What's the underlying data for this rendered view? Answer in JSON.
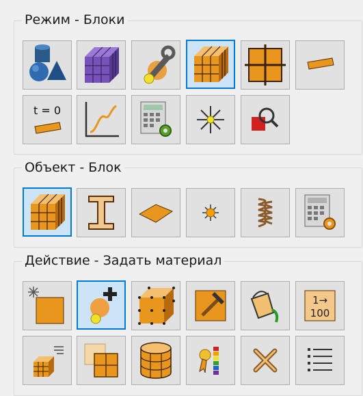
{
  "colors": {
    "selected_border": "#0078d7",
    "selected_bg": "#cce4f7",
    "button_bg": "#e1e1e1"
  },
  "sections": [
    {
      "title": "Режим - Блоки",
      "buttons": [
        {
          "icon": "primitives-icon",
          "selected": false
        },
        {
          "icon": "purple-block-icon",
          "selected": false
        },
        {
          "icon": "tools-icon",
          "selected": false
        },
        {
          "icon": "block-icon",
          "selected": true
        },
        {
          "icon": "grid-icon",
          "selected": false
        },
        {
          "icon": "plank-icon",
          "selected": false
        },
        {
          "icon": "initial-condition-icon",
          "label": "t = 0",
          "selected": false
        },
        {
          "icon": "graph-icon",
          "selected": false
        },
        {
          "icon": "calculator-icon",
          "selected": false
        },
        {
          "icon": "light-icon",
          "selected": false
        },
        {
          "icon": "zoom-icon",
          "selected": false
        }
      ]
    },
    {
      "title": "Объект - Блок",
      "buttons": [
        {
          "icon": "block-icon",
          "selected": true
        },
        {
          "icon": "i-beam-icon",
          "selected": false
        },
        {
          "icon": "plate-icon",
          "selected": false
        },
        {
          "icon": "point-light-icon",
          "selected": false
        },
        {
          "icon": "spring-icon",
          "selected": false
        },
        {
          "icon": "calculator-icon",
          "selected": false
        }
      ]
    },
    {
      "title": "Действие - Задать материал",
      "buttons": [
        {
          "icon": "new-block-icon",
          "selected": false
        },
        {
          "icon": "add-material-icon",
          "selected": true
        },
        {
          "icon": "box-nodes-icon",
          "selected": false
        },
        {
          "icon": "hammer-icon",
          "selected": false
        },
        {
          "icon": "paint-bucket-icon",
          "selected": false
        },
        {
          "icon": "numbering-icon",
          "label_top": "1→",
          "label_bottom": "100",
          "selected": false
        },
        {
          "icon": "small-block-icon",
          "selected": false
        },
        {
          "icon": "layers-icon",
          "selected": false
        },
        {
          "icon": "cylinder-icon",
          "selected": false
        },
        {
          "icon": "material-ribbon-icon",
          "selected": false
        },
        {
          "icon": "delete-icon",
          "selected": false
        },
        {
          "icon": "list-icon",
          "selected": false
        }
      ]
    }
  ]
}
